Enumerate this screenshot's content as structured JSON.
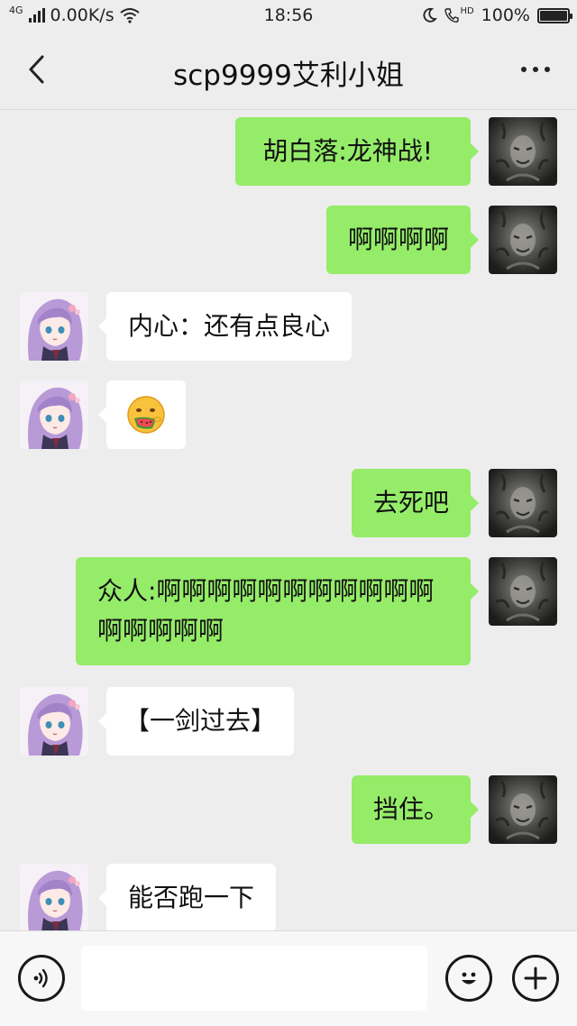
{
  "status_bar": {
    "network": "4G",
    "speed": "0.00K/s",
    "time": "18:56",
    "hd": "HD",
    "battery_percent": "100%",
    "battery_level": 1.0
  },
  "header": {
    "title": "scp9999艾利小姐"
  },
  "messages": [
    {
      "sender": "self",
      "text": "胡白落:龙神战!"
    },
    {
      "sender": "self",
      "text": "啊啊啊啊"
    },
    {
      "sender": "other",
      "text": "内心：还有点良心"
    },
    {
      "sender": "other",
      "emoji": "eating-watermelon-emoji"
    },
    {
      "sender": "self",
      "text": "去死吧"
    },
    {
      "sender": "self",
      "text": "众人:啊啊啊啊啊啊啊啊啊啊啊啊啊啊啊啊"
    },
    {
      "sender": "other",
      "text": "【一剑过去】"
    },
    {
      "sender": "self",
      "text": "挡住。"
    },
    {
      "sender": "other",
      "text": "能否跑一下"
    }
  ],
  "input_bar": {
    "text_value": "",
    "icons": [
      "voice-icon",
      "emoji-icon",
      "plus-icon"
    ]
  },
  "colors": {
    "self_bubble": "#95ec69",
    "other_bubble": "#ffffff",
    "background": "#ededed"
  }
}
